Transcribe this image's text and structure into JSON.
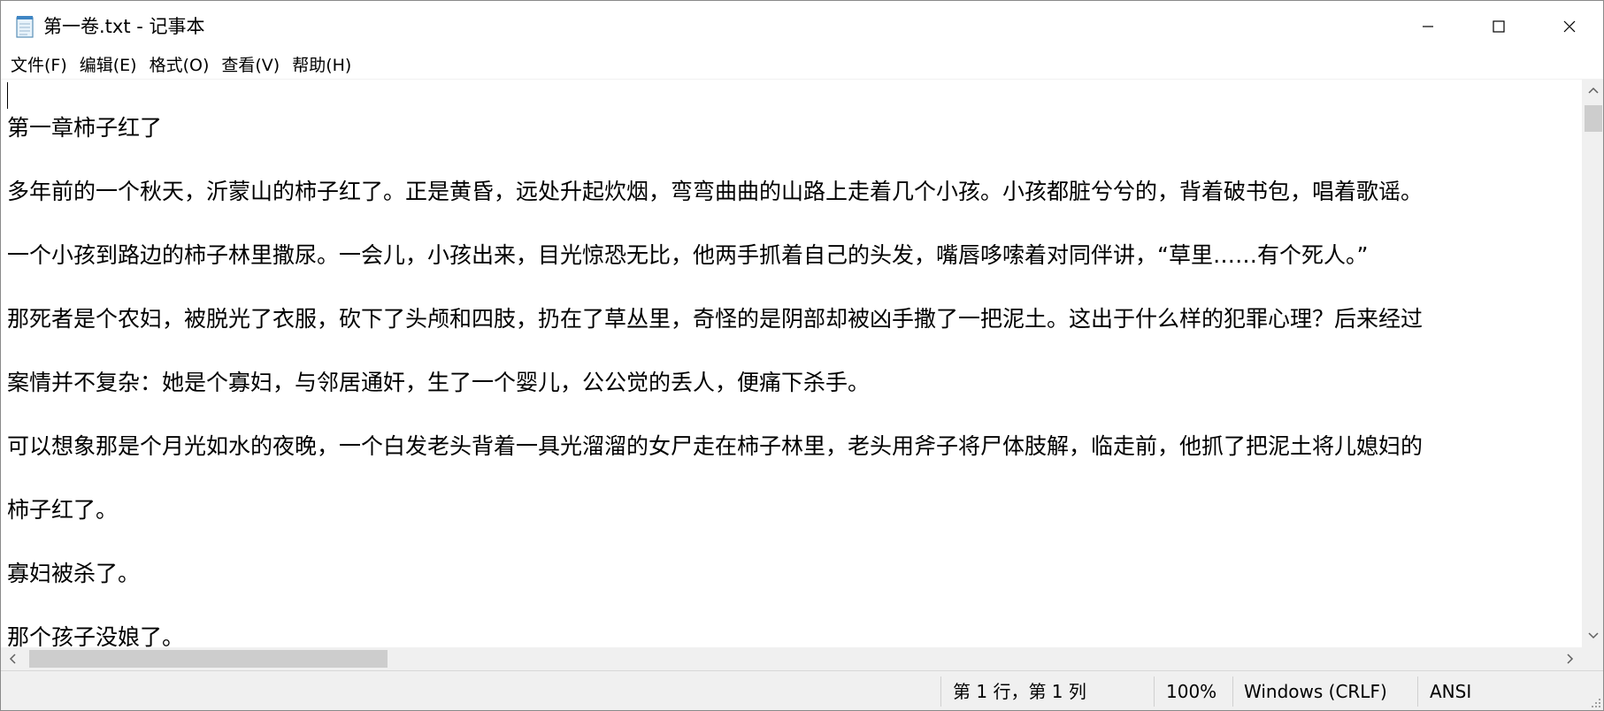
{
  "window": {
    "title": "第一卷.txt - 记事本",
    "app_icon": "notepad-icon"
  },
  "title_buttons": {
    "minimize_icon": "minimize-icon",
    "maximize_icon": "maximize-icon",
    "close_icon": "close-icon"
  },
  "menu": {
    "items": [
      {
        "label": "文件(F)"
      },
      {
        "label": "编辑(E)"
      },
      {
        "label": "格式(O)"
      },
      {
        "label": "查看(V)"
      },
      {
        "label": "帮助(H)"
      }
    ]
  },
  "document": {
    "lines": [
      "第一章柿子红了",
      "多年前的一个秋天，沂蒙山的柿子红了。正是黄昏，远处升起炊烟，弯弯曲曲的山路上走着几个小孩。小孩都脏兮兮的，背着破书包，唱着歌谣。",
      "一个小孩到路边的柿子林里撒尿。一会儿，小孩出来，目光惊恐无比，他两手抓着自己的头发，嘴唇哆嗦着对同伴讲，“草里……有个死人。”",
      "那死者是个农妇，被脱光了衣服，砍下了头颅和四肢，扔在了草丛里，奇怪的是阴部却被凶手撒了一把泥土。这出于什么样的犯罪心理？后来经过",
      "案情并不复杂：她是个寡妇，与邻居通奸，生了一个婴儿，公公觉的丢人，便痛下杀手。",
      "可以想象那是个月光如水的夜晚，一个白发老头背着一具光溜溜的女尸走在柿子林里，老头用斧子将尸体肢解，临走前，他抓了把泥土将儿媳妇的",
      "柿子红了。",
      "寡妇被杀了。",
      "那个孩子没娘了。"
    ]
  },
  "status": {
    "position": "第 1 行，第 1 列",
    "zoom": "100%",
    "line_ending": "Windows (CRLF)",
    "encoding": "ANSI"
  },
  "colors": {
    "status_bg": "#f0f0f0",
    "scroll_thumb": "#cdcdcd",
    "text": "#000000"
  }
}
